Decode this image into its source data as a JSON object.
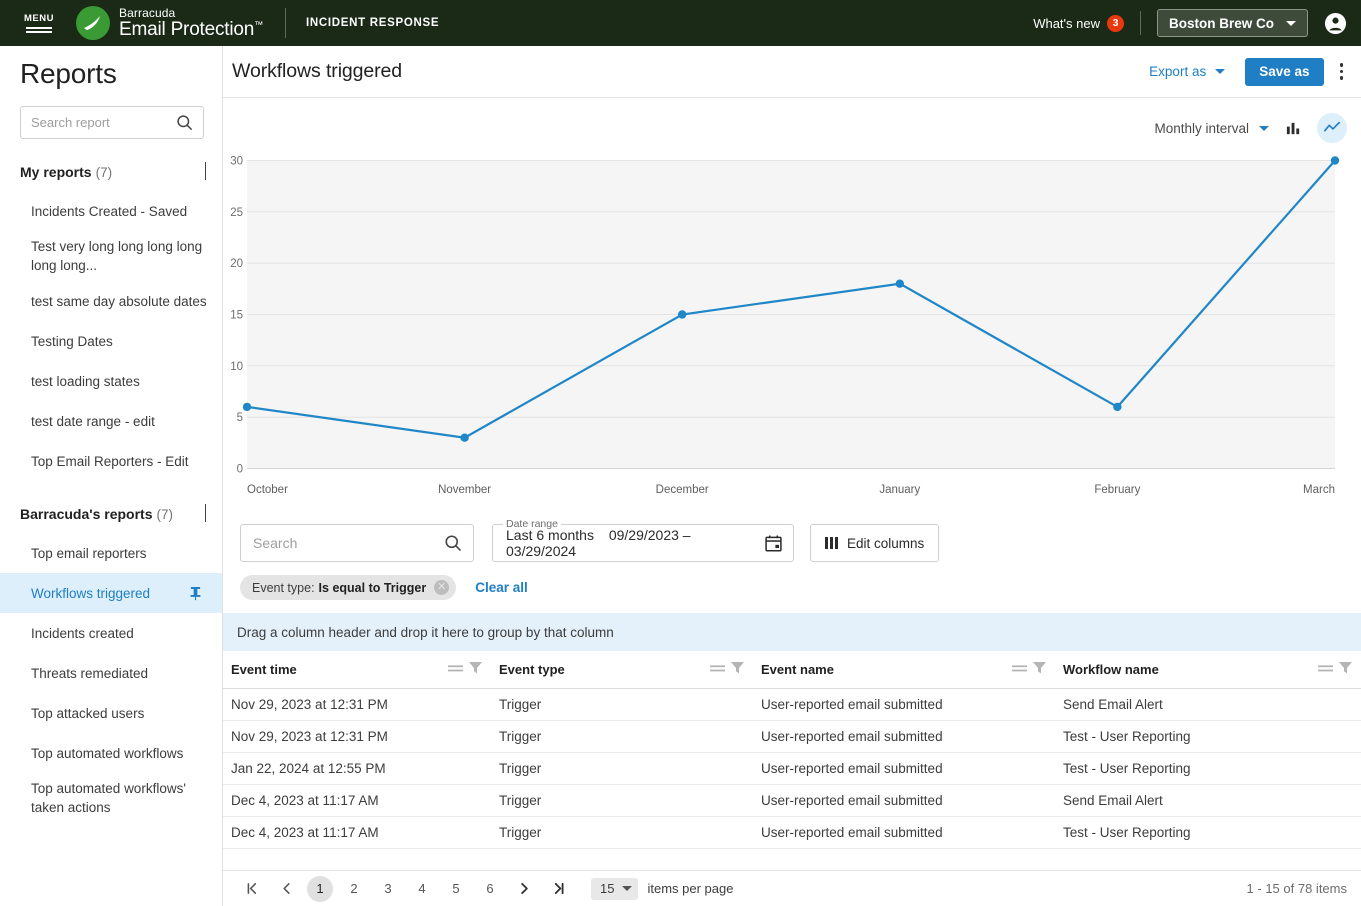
{
  "topbar": {
    "menu_label": "MENU",
    "brand_line1": "Barracuda",
    "brand_line2": "Email Protection",
    "brand_tm": "™",
    "product": "INCIDENT RESPONSE",
    "whats_new": "What's new",
    "whats_new_count": "3",
    "tenant": "Boston Brew Co",
    "account_icon": "account-circle-icon",
    "bg_color": "#1b2a17",
    "logo_color": "#3a9b35",
    "badge_color": "#e8380d"
  },
  "sidebar": {
    "title": "Reports",
    "search": {
      "placeholder": "Search report",
      "value": "",
      "icon": "search-icon"
    },
    "groups": [
      {
        "label": "My reports",
        "count": "(7)",
        "expanded": true,
        "items": [
          {
            "label": "Incidents Created - Saved",
            "active": false,
            "pinned": false
          },
          {
            "label": "Test very long long long long long long...",
            "active": false,
            "pinned": false
          },
          {
            "label": "test same day absolute dates",
            "active": false,
            "pinned": false
          },
          {
            "label": "Testing Dates",
            "active": false,
            "pinned": false
          },
          {
            "label": "test loading states",
            "active": false,
            "pinned": false
          },
          {
            "label": "test date range - edit",
            "active": false,
            "pinned": false
          },
          {
            "label": "Top Email Reporters - Edit",
            "active": false,
            "pinned": false
          }
        ]
      },
      {
        "label": "Barracuda's reports",
        "count": "(7)",
        "expanded": true,
        "items": [
          {
            "label": "Top email reporters",
            "active": false,
            "pinned": false
          },
          {
            "label": "Workflows triggered",
            "active": true,
            "pinned": true
          },
          {
            "label": "Incidents created",
            "active": false,
            "pinned": false
          },
          {
            "label": "Threats remediated",
            "active": false,
            "pinned": false
          },
          {
            "label": "Top attacked users",
            "active": false,
            "pinned": false
          },
          {
            "label": "Top automated workflows",
            "active": false,
            "pinned": false
          },
          {
            "label": "Top automated workflows' taken actions",
            "active": false,
            "pinned": false
          }
        ]
      }
    ]
  },
  "page": {
    "title": "Workflows triggered",
    "export_label": "Export as",
    "save_label": "Save as",
    "kebab_icon": "more-vertical-icon",
    "accent_color": "#1f7ec4"
  },
  "chart_toolbar": {
    "interval_label": "Monthly interval",
    "bar_icon": "bar-chart-icon",
    "line_icon": "line-chart-icon",
    "selected_type": "line"
  },
  "chart_data": {
    "type": "line",
    "title": "Workflows triggered",
    "categories": [
      "October",
      "November",
      "December",
      "January",
      "February",
      "March"
    ],
    "values": [
      6,
      3,
      15,
      18,
      6,
      30
    ],
    "series": [
      {
        "name": "Workflows triggered",
        "values": [
          6,
          3,
          15,
          18,
          6,
          30
        ]
      }
    ],
    "xlabel": "",
    "ylabel": "",
    "ylim": [
      0,
      30
    ],
    "yticks": [
      0,
      5,
      10,
      15,
      20,
      25,
      30
    ],
    "grid": true,
    "legend": "none",
    "line_color": "#1f86c8",
    "plot_bg": "#f5f5f5"
  },
  "filters": {
    "search": {
      "placeholder": "Search",
      "value": "",
      "icon": "search-icon"
    },
    "date_range": {
      "legend": "Date range",
      "preset": "Last 6 months",
      "range": "09/29/2023 – 03/29/2024",
      "icon": "calendar-icon"
    },
    "edit_columns": {
      "label": "Edit columns",
      "icon": "columns-icon"
    },
    "chips": [
      {
        "field": "Event type:",
        "value": "Is equal to Trigger",
        "remove_icon": "close-circle-icon"
      }
    ],
    "clear_all": "Clear all"
  },
  "group_band": {
    "text": "Drag a column header and drop it here to group by that column"
  },
  "table": {
    "columns": [
      {
        "label": "Event time",
        "equals_icon": "equals-icon",
        "filter_icon": "funnel-icon"
      },
      {
        "label": "Event type",
        "equals_icon": "equals-icon",
        "filter_icon": "funnel-icon"
      },
      {
        "label": "Event name",
        "equals_icon": "equals-icon",
        "filter_icon": "funnel-icon"
      },
      {
        "label": "Workflow name",
        "equals_icon": "equals-icon",
        "filter_icon": "funnel-icon"
      }
    ],
    "rows": [
      [
        "Nov 29, 2023 at 12:31 PM",
        "Trigger",
        "User-reported email submitted",
        "Send Email Alert"
      ],
      [
        "Nov 29, 2023 at 12:31 PM",
        "Trigger",
        "User-reported email submitted",
        "Test - User Reporting"
      ],
      [
        "Jan 22, 2024 at 12:55 PM",
        "Trigger",
        "User-reported email submitted",
        "Test - User Reporting"
      ],
      [
        "Dec 4, 2023 at 11:17 AM",
        "Trigger",
        "User-reported email submitted",
        "Send Email Alert"
      ],
      [
        "Dec 4, 2023 at 11:17 AM",
        "Trigger",
        "User-reported email submitted",
        "Test - User Reporting"
      ]
    ]
  },
  "pager": {
    "first_icon": "first-page-icon",
    "prev_icon": "prev-page-icon",
    "pages": [
      "1",
      "2",
      "3",
      "4",
      "5",
      "6"
    ],
    "current_page": "1",
    "next_icon": "next-page-icon",
    "last_icon": "last-page-icon",
    "items_per_page_value": "15",
    "items_per_page_label": "items per page",
    "range_text": "1 - 15 of 78 items"
  }
}
